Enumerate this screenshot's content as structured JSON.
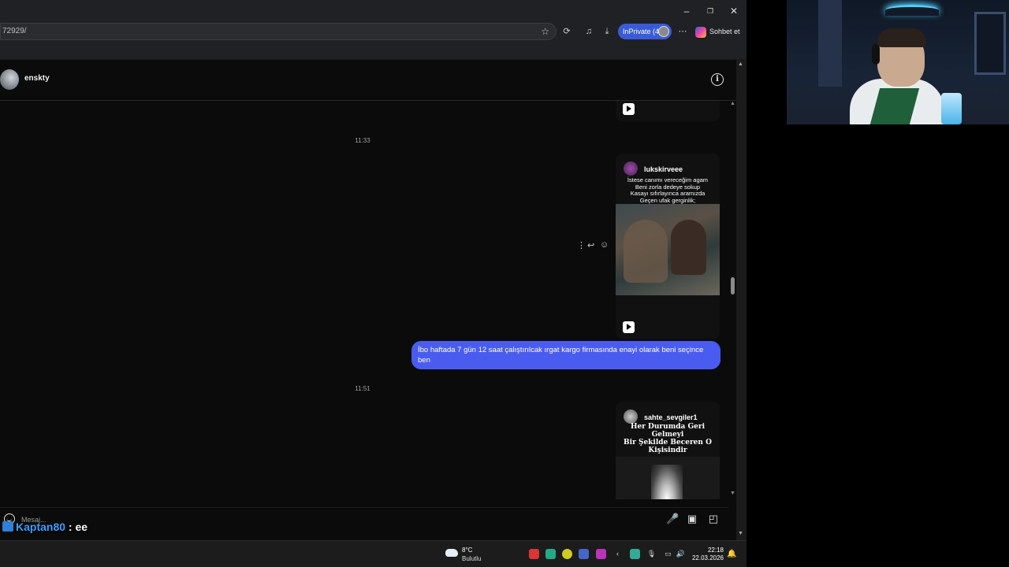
{
  "browser": {
    "address_text": "72929/",
    "inprivate_label": "InPrivate (4)",
    "copilot_label": "Sohbet et",
    "window_controls": [
      "–",
      "❐",
      "✕"
    ]
  },
  "chat": {
    "contact_name": "enskty",
    "timestamps": [
      "11:33",
      "11:51"
    ],
    "reels": [
      {
        "username": "lukskirveee",
        "caption": [
          "İstese canımı vereceğim agam",
          "Beni zorla dedeye sokup",
          "Kasayı sıfırlayınca aramızda",
          "Geçen ufak gerginlik;"
        ]
      },
      {
        "username": "sahte_sevgiler1",
        "caption": [
          "Her Durumda Geri Gelmeyi",
          "Bir Şekilde Beceren O",
          "Kişisindir"
        ]
      }
    ],
    "sent_message": "İbo haftada 7 gün 12 saat çalıştırılcak ırgat kargo firmasında enayi olarak beni seçince ben",
    "composer_placeholder": "Mesaj..."
  },
  "overlay": {
    "username": "Kaptan80",
    "text": " : ee"
  },
  "taskbar": {
    "weather_temp": "8°C",
    "weather_desc": "Bulutlu",
    "time": "22:18",
    "date": "22.03.2026"
  },
  "icons": {
    "reply": "↩",
    "more": "⋮",
    "emoji": "☺",
    "mic": "🎙",
    "image": "▣",
    "sticker": "◰"
  }
}
